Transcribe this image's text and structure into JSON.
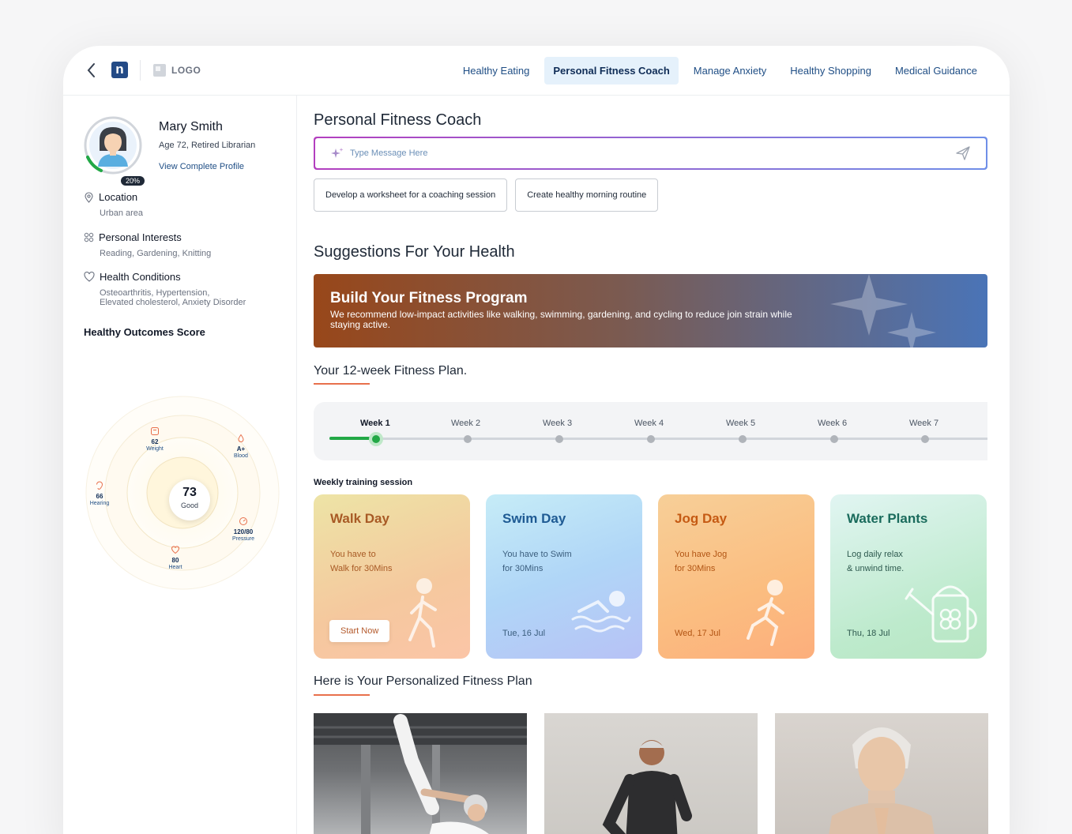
{
  "header": {
    "logo_text": "LOGO",
    "brand_letter": "n",
    "tabs": [
      {
        "label": "Healthy Eating",
        "active": false
      },
      {
        "label": "Personal Fitness Coach",
        "active": true
      },
      {
        "label": "Manage Anxiety",
        "active": false
      },
      {
        "label": "Healthy Shopping",
        "active": false
      },
      {
        "label": "Medical Guidance",
        "active": false
      }
    ]
  },
  "profile": {
    "name": "Mary Smith",
    "meta": "Age 72, Retired Librarian",
    "link": "View Complete Profile",
    "completion": "20%",
    "location_label": "Location",
    "location_value": "Urban area",
    "interests_label": "Personal Interests",
    "interests_value": "Reading, Gardening, Knitting",
    "conditions_label": "Health Conditions",
    "conditions_line1": "Osteoarthritis, Hypertension,",
    "conditions_line2": "Elevated cholesterol, Anxiety Disorder"
  },
  "score": {
    "title": "Healthy Outcomes Score",
    "value": "73",
    "status": "Good",
    "metrics": [
      {
        "value": "62",
        "label": "Weight",
        "icon": "scale-icon"
      },
      {
        "value": "A+",
        "label": "Blood",
        "icon": "blood-icon"
      },
      {
        "value": "66",
        "label": "Hearing",
        "icon": "ear-icon"
      },
      {
        "value": "120/80",
        "label": "Pressure",
        "icon": "pressure-icon"
      },
      {
        "value": "80",
        "label": "Heart",
        "icon": "heart-icon"
      }
    ]
  },
  "coach": {
    "title": "Personal Fitness Coach",
    "placeholder": "Type Message Here",
    "chips": [
      "Develop a worksheet for a coaching session",
      "Create healthy morning routine"
    ]
  },
  "suggestions": {
    "title": "Suggestions For Your Health",
    "banner_title": "Build Your Fitness Program",
    "banner_text": "We recommend low-impact activities like walking, swimming, gardening, and cycling to reduce join strain while staying active."
  },
  "plan": {
    "title": "Your 12-week Fitness Plan.",
    "weeks": [
      "Week 1",
      "Week 2",
      "Week 3",
      "Week 4",
      "Week 5",
      "Week 6",
      "Week 7"
    ],
    "current_week": 1,
    "weekly_label": "Weekly training session",
    "cards": [
      {
        "title": "Walk Day",
        "line1": "You have to",
        "line2": "Walk for 30Mins",
        "date": "",
        "button": "Start Now"
      },
      {
        "title": "Swim Day",
        "line1": "You have to Swim",
        "line2": "for 30Mins",
        "date": "Tue, 16 Jul"
      },
      {
        "title": "Jog Day",
        "line1": "You have Jog",
        "line2": "for 30Mins",
        "date": "Wed, 17 Jul"
      },
      {
        "title": "Water Plants",
        "line1": "Log daily relax",
        "line2": "& unwind time.",
        "date": "Thu, 18 Jul"
      }
    ]
  },
  "personalized": {
    "title": "Here is Your Personalized Fitness Plan"
  },
  "colors": {
    "accent": "#1f4e85",
    "underline": "#e8704c",
    "progress": "#22a846"
  }
}
